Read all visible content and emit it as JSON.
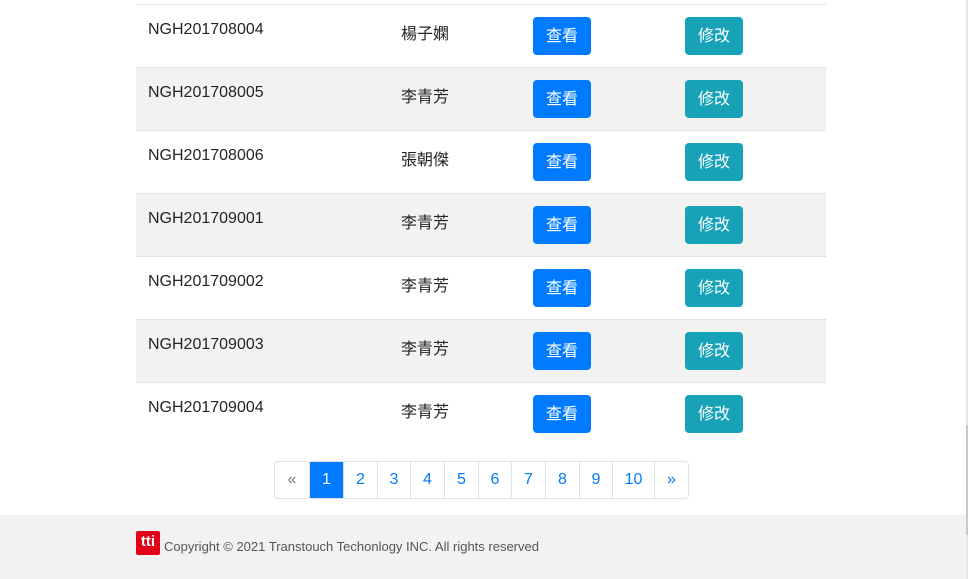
{
  "table": {
    "view_label": "查看",
    "edit_label": "修改",
    "rows": [
      {
        "id": "NGH201708004",
        "name": "楊子嫻"
      },
      {
        "id": "NGH201708005",
        "name": "李青芳"
      },
      {
        "id": "NGH201708006",
        "name": "張朝傑"
      },
      {
        "id": "NGH201709001",
        "name": "李青芳"
      },
      {
        "id": "NGH201709002",
        "name": "李青芳"
      },
      {
        "id": "NGH201709003",
        "name": "李青芳"
      },
      {
        "id": "NGH201709004",
        "name": "李青芳"
      }
    ]
  },
  "pagination": {
    "prev": "«",
    "next": "»",
    "pages": [
      "1",
      "2",
      "3",
      "4",
      "5",
      "6",
      "7",
      "8",
      "9",
      "10"
    ],
    "active_page": "1"
  },
  "footer": {
    "logo_text": "tti",
    "copyright": "Copyright © 2021 Transtouch Techonlogy INC. All rights reserved"
  },
  "colors": {
    "primary": "#007bff",
    "info": "#17a2b8",
    "logo_red": "#e3001b"
  }
}
